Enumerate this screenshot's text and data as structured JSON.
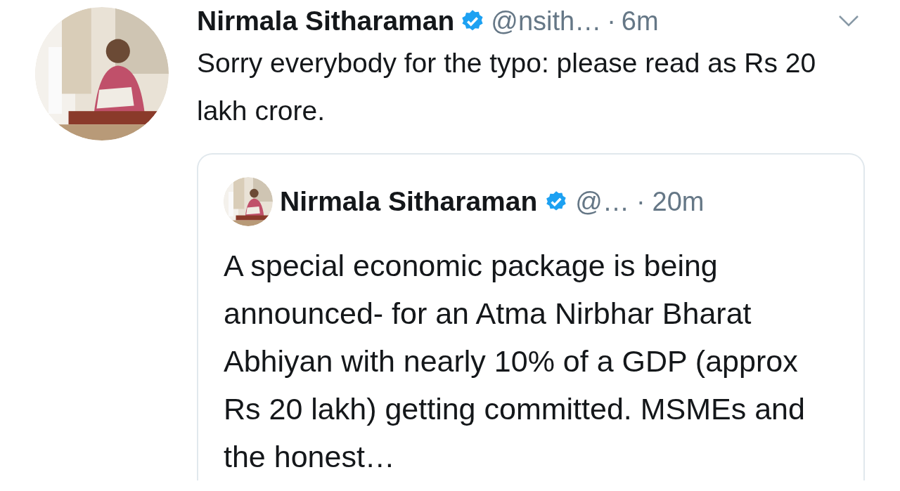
{
  "tweet": {
    "author": {
      "name": "Nirmala Sitharaman",
      "verified": true,
      "handle": "@nsith…"
    },
    "separator": "·",
    "time": "6m",
    "menu": true,
    "text": "Sorry everybody for the typo: please read as Rs 20 lakh crore.",
    "quoted": {
      "author": {
        "name": "Nirmala Sitharaman",
        "verified": true,
        "handle": "@…"
      },
      "separator": "·",
      "time": "20m",
      "text": "A special economic package is being announced- for an Atma Nirbhar Bharat Abhiyan with nearly 10% of a GDP (approx Rs 20 lakh) getting committed. MSMEs and the honest…"
    }
  }
}
